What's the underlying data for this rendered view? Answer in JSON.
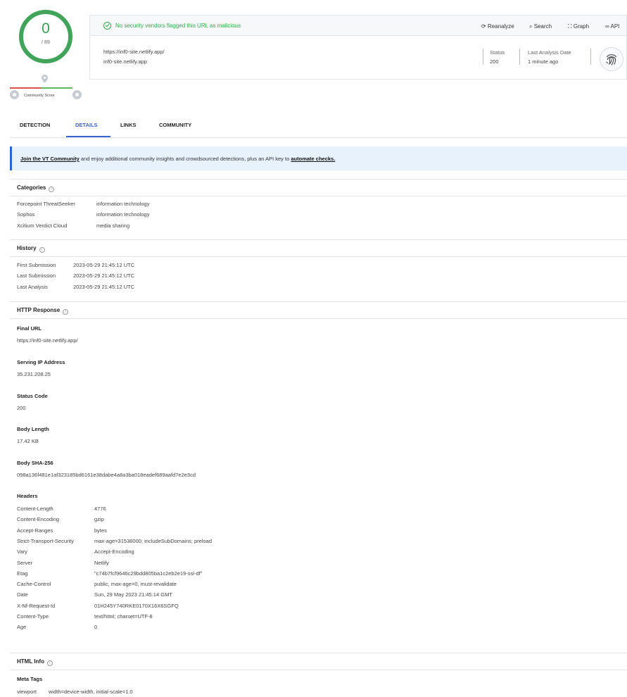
{
  "score": {
    "detections": "0",
    "total": "/ 89",
    "community_label": "Community Score"
  },
  "banner": {
    "message": "No security vendors flagged this URL as malicious"
  },
  "actions": {
    "reanalyze": "Reanalyze",
    "search": "Search",
    "graph": "Graph",
    "api": "API"
  },
  "url": {
    "full": "https://inf0-site.netlify.app/",
    "host": "inf0-site.netlify.app"
  },
  "status": {
    "label": "Status",
    "value": "200"
  },
  "last_analysis": {
    "label": "Last Analysis Date",
    "value": "1 minute ago"
  },
  "tabs": [
    {
      "label": "DETECTION"
    },
    {
      "label": "DETAILS"
    },
    {
      "label": "LINKS"
    },
    {
      "label": "COMMUNITY"
    }
  ],
  "info_banner": {
    "link1": "Join the VT Community",
    "middle": " and enjoy additional community insights and crowdsourced detections, plus an API key to ",
    "link2": "automate checks."
  },
  "categories": {
    "title": "Categories",
    "rows": [
      {
        "vendor": "Forcepoint ThreatSeeker",
        "value": "information technology"
      },
      {
        "vendor": "Sophos",
        "value": "information technology"
      },
      {
        "vendor": "Xcitium Verdict Cloud",
        "value": "media sharing"
      }
    ]
  },
  "history": {
    "title": "History",
    "rows": [
      {
        "key": "First Submission",
        "value": "2023-05-29 21:45:12 UTC"
      },
      {
        "key": "Last Submission",
        "value": "2023-05-29 21:45:12 UTC"
      },
      {
        "key": "Last Analysis",
        "value": "2023-05-29 21:45:12 UTC"
      }
    ]
  },
  "http": {
    "title": "HTTP Response",
    "final_url_label": "Final URL",
    "final_url": "https://inf0-site.netlify.app/",
    "ip_label": "Serving IP Address",
    "ip": "35.231.208.25",
    "status_label": "Status Code",
    "status": "200",
    "body_len_label": "Body Length",
    "body_len": "17.42 KB",
    "sha_label": "Body SHA-256",
    "sha": "098a136f481e1af323185bd6161e38dabe4a8a3ba018eadef689aafd7e2e3cd",
    "headers_label": "Headers",
    "headers": [
      {
        "key": "Content-Length",
        "value": "4776"
      },
      {
        "key": "Content-Encoding",
        "value": "gzip"
      },
      {
        "key": "Accept-Ranges",
        "value": "bytes"
      },
      {
        "key": "Strict-Transport-Security",
        "value": "max-age=31536000; includeSubDomains; preload"
      },
      {
        "key": "Vary",
        "value": "Accept-Encoding"
      },
      {
        "key": "Server",
        "value": "Netlify"
      },
      {
        "key": "Etag",
        "value": "\"c74b7fcf9646c29bdd805ba1c2eb2e19-ssl-df\""
      },
      {
        "key": "Cache-Control",
        "value": "public, max-age=0, must-revalidate"
      },
      {
        "key": "Date",
        "value": "Sun, 29 May 2023 21:45:14 GMT"
      },
      {
        "key": "X-Nf-Request-Id",
        "value": "01H245Y740RKE0170X16X6SGFQ"
      },
      {
        "key": "Content-Type",
        "value": "text/html; charset=UTF-8"
      },
      {
        "key": "Age",
        "value": "0"
      }
    ]
  },
  "html_info": {
    "title": "HTML Info",
    "meta_label": "Meta Tags",
    "meta": [
      {
        "key": "viewport",
        "value": "width=device-width, initial-scale=1.0"
      }
    ]
  },
  "colors": {
    "clean": "#37a64f",
    "accent": "#3b63d3",
    "banner_bg": "#e8f2fd"
  },
  "icons": [
    "check-circle-icon",
    "reanalyze-icon",
    "search-icon",
    "graph-icon",
    "api-icon",
    "fingerprint-icon",
    "location-pin-icon",
    "info-icon"
  ]
}
